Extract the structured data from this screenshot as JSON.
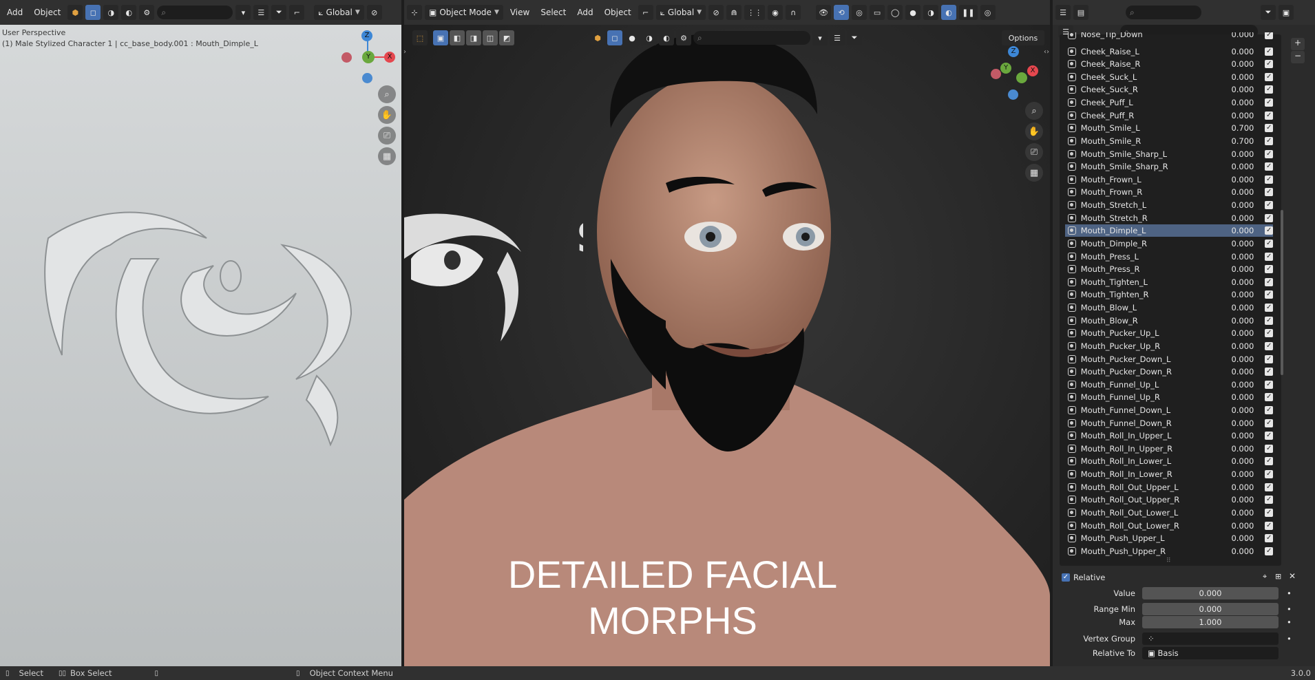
{
  "left_viewport": {
    "header": {
      "add": "Add",
      "object": "Object",
      "orientation": "Global"
    },
    "overlay_line1": "User Perspective",
    "overlay_line2": "(1) Male Stylized Character 1 | cc_base_body.001 : Mouth_Dimple_L",
    "gizmo": {
      "z": "Z",
      "y": "Y",
      "x": "X"
    }
  },
  "main_viewport": {
    "header": {
      "mode": "Object Mode",
      "view": "View",
      "select": "Select",
      "add": "Add",
      "object": "Object",
      "orientation": "Global"
    },
    "options": "Options",
    "caption_line1": "DETAILED FACIAL",
    "caption_line2": "MORPHS",
    "gizmo": {
      "z": "Z",
      "y": "Y",
      "x": "X"
    }
  },
  "shape_keys": [
    {
      "name": "Nose_Tip_Down",
      "value": "0.000"
    },
    {
      "name": "Cheek_Raise_L",
      "value": "0.000"
    },
    {
      "name": "Cheek_Raise_R",
      "value": "0.000"
    },
    {
      "name": "Cheek_Suck_L",
      "value": "0.000"
    },
    {
      "name": "Cheek_Suck_R",
      "value": "0.000"
    },
    {
      "name": "Cheek_Puff_L",
      "value": "0.000"
    },
    {
      "name": "Cheek_Puff_R",
      "value": "0.000"
    },
    {
      "name": "Mouth_Smile_L",
      "value": "0.700"
    },
    {
      "name": "Mouth_Smile_R",
      "value": "0.700"
    },
    {
      "name": "Mouth_Smile_Sharp_L",
      "value": "0.000"
    },
    {
      "name": "Mouth_Smile_Sharp_R",
      "value": "0.000"
    },
    {
      "name": "Mouth_Frown_L",
      "value": "0.000"
    },
    {
      "name": "Mouth_Frown_R",
      "value": "0.000"
    },
    {
      "name": "Mouth_Stretch_L",
      "value": "0.000"
    },
    {
      "name": "Mouth_Stretch_R",
      "value": "0.000"
    },
    {
      "name": "Mouth_Dimple_L",
      "value": "0.000"
    },
    {
      "name": "Mouth_Dimple_R",
      "value": "0.000"
    },
    {
      "name": "Mouth_Press_L",
      "value": "0.000"
    },
    {
      "name": "Mouth_Press_R",
      "value": "0.000"
    },
    {
      "name": "Mouth_Tighten_L",
      "value": "0.000"
    },
    {
      "name": "Mouth_Tighten_R",
      "value": "0.000"
    },
    {
      "name": "Mouth_Blow_L",
      "value": "0.000"
    },
    {
      "name": "Mouth_Blow_R",
      "value": "0.000"
    },
    {
      "name": "Mouth_Pucker_Up_L",
      "value": "0.000"
    },
    {
      "name": "Mouth_Pucker_Up_R",
      "value": "0.000"
    },
    {
      "name": "Mouth_Pucker_Down_L",
      "value": "0.000"
    },
    {
      "name": "Mouth_Pucker_Down_R",
      "value": "0.000"
    },
    {
      "name": "Mouth_Funnel_Up_L",
      "value": "0.000"
    },
    {
      "name": "Mouth_Funnel_Up_R",
      "value": "0.000"
    },
    {
      "name": "Mouth_Funnel_Down_L",
      "value": "0.000"
    },
    {
      "name": "Mouth_Funnel_Down_R",
      "value": "0.000"
    },
    {
      "name": "Mouth_Roll_In_Upper_L",
      "value": "0.000"
    },
    {
      "name": "Mouth_Roll_In_Upper_R",
      "value": "0.000"
    },
    {
      "name": "Mouth_Roll_In_Lower_L",
      "value": "0.000"
    },
    {
      "name": "Mouth_Roll_In_Lower_R",
      "value": "0.000"
    },
    {
      "name": "Mouth_Roll_Out_Upper_L",
      "value": "0.000"
    },
    {
      "name": "Mouth_Roll_Out_Upper_R",
      "value": "0.000"
    },
    {
      "name": "Mouth_Roll_Out_Lower_L",
      "value": "0.000"
    },
    {
      "name": "Mouth_Roll_Out_Lower_R",
      "value": "0.000"
    },
    {
      "name": "Mouth_Push_Upper_L",
      "value": "0.000"
    },
    {
      "name": "Mouth_Push_Upper_R",
      "value": "0.000"
    }
  ],
  "selected_shape_key": "Mouth_Dimple_L",
  "properties": {
    "relative_label": "Relative",
    "value_label": "Value",
    "value": "0.000",
    "range_min_label": "Range Min",
    "range_min": "0.000",
    "max_label": "Max",
    "max": "1.000",
    "vertex_group_label": "Vertex Group",
    "vertex_group": "",
    "relative_to_label": "Relative To",
    "relative_to": "Basis"
  },
  "status_bar": {
    "select": "Select",
    "box_select": "Box Select",
    "context_menu": "Object Context Menu",
    "version": "3.0.0"
  },
  "colors": {
    "accent": "#4772b3",
    "selection": "#4e6383",
    "axis_x": "#e5474e",
    "axis_y": "#6aa83d",
    "axis_z": "#3d87d6"
  }
}
